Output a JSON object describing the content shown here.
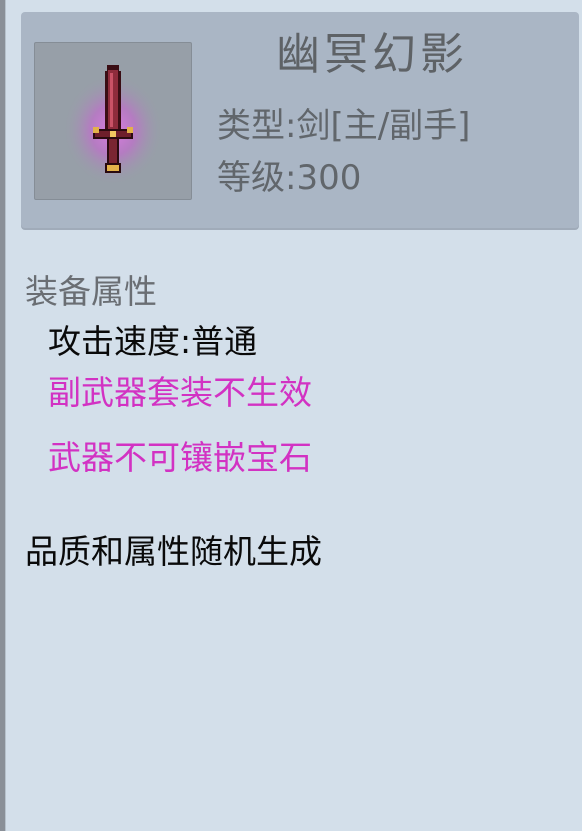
{
  "item": {
    "name": "幽冥幻影",
    "type_line": "类型:剑[主/副手]",
    "level_line": "等级:300",
    "icon": "sword-icon"
  },
  "attributes": {
    "section_title": "装备属性",
    "lines": [
      {
        "text": "攻击速度:普通",
        "color": "#0a0a0a"
      },
      {
        "text": "副武器套装不生效",
        "color": "#d232c3"
      },
      {
        "text": "武器不可镶嵌宝石",
        "color": "#d232c3"
      }
    ]
  },
  "notes": {
    "quality": "品质和属性随机生成"
  },
  "colors": {
    "panel": "#d3dfea",
    "header": "#aab6c5",
    "highlight": "#d232c3",
    "glow": "#d86ee0"
  }
}
